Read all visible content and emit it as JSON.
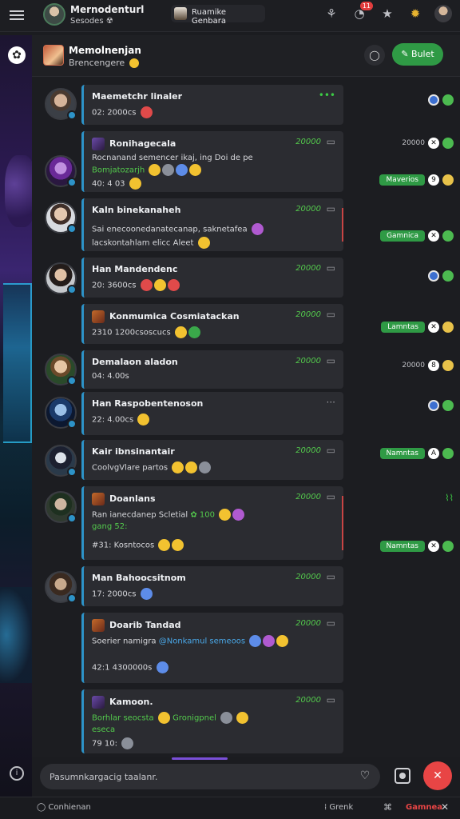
{
  "topbar": {
    "title": "Mernodenturl",
    "subtitle": "Sesodes",
    "channel": "Ruamike Genbara",
    "notifications": "11"
  },
  "channel": {
    "title": "Memolnenjan",
    "subtitle": "Brencengere",
    "action_label": "Bulet"
  },
  "messages": [
    {
      "name": "Maemetchr linaler",
      "line1": "02: 2000cs",
      "time": ""
    },
    {
      "name": "Ronihagecala",
      "line1": "Rocnanand semencer ikaj, ing Doi de pe",
      "line2": "Bomjatozarjh",
      "line3": "40: 4 03",
      "time": "20000"
    },
    {
      "name": "Kaln binekanaheh",
      "line1": "Sai enecoonedanatecanap, saknetafea",
      "line2": "lacskontahlam elicc Aleet",
      "time": "20000"
    },
    {
      "name": "Han Mandendenc",
      "line1": "20: 3600cs",
      "time": "20000"
    },
    {
      "name": "Konmumica Cosmiatackan",
      "line1": "2310 1200csoscucs",
      "time": "20000"
    },
    {
      "name": "Demalaon aladon",
      "line1": "04: 4.00s",
      "time": "20000"
    },
    {
      "name": "Han Raspobentenoson",
      "line1": "22: 4.00cs",
      "time": ""
    },
    {
      "name": "Kair ibnsinantair",
      "line1": "CoolvgVlare partos",
      "time": "20000"
    },
    {
      "name": "Doanlans",
      "line1": "Ran ianecdanep Scletial",
      "line2": "gang 52:",
      "line3": "#31: Kosntocos",
      "time": "20000"
    },
    {
      "name": "Man Bahoocsitnom",
      "line1": "17: 2000cs",
      "time": "20000"
    },
    {
      "name": "Doarib Tandad",
      "line1": "Soerier namigra",
      "line1_link": "@Nonkamul semeoos",
      "line3": "42:1 4300000s",
      "time": "20000"
    },
    {
      "name": "Kamoon.",
      "line1": "Borhlar seocsta",
      "line1_b": "Gronigpnel",
      "line2": "eseca",
      "line3": "79 10:",
      "time": "20000"
    }
  ],
  "rail": [
    {
      "time": "",
      "pill": ""
    },
    {
      "time": "20000",
      "pill": ""
    },
    {
      "time": "",
      "pill": "Maverios"
    },
    {
      "time": "",
      "pill": "Gamnica"
    },
    {
      "time": "",
      "pill": ""
    },
    {
      "time": "",
      "pill": "Lamntas"
    },
    {
      "time": "20000",
      "pill": ""
    },
    {
      "time": "",
      "pill": ""
    },
    {
      "time": "",
      "pill": "Namntas"
    },
    {
      "time": "",
      "pill": "Namntas"
    }
  ],
  "composer": {
    "placeholder": "Pasumnkargacig taalanr."
  },
  "bottombar": {
    "left": "Conhienan",
    "mid": "Grenk",
    "right": "Gamnea"
  },
  "colors": {
    "accent_green": "#2f9a45",
    "accent_blue": "#2d93c8",
    "alert_red": "#e84545",
    "bg": "#1c1d21"
  }
}
